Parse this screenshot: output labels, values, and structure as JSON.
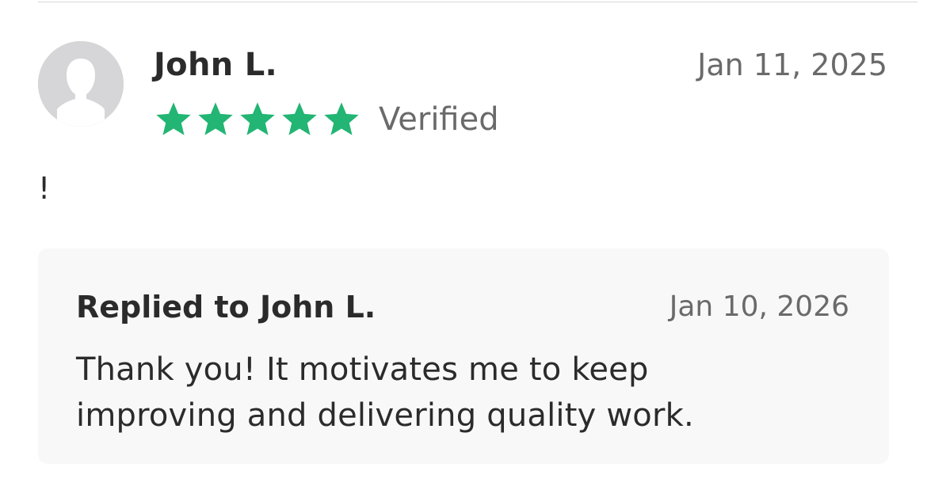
{
  "review": {
    "reviewer_name": "John L.",
    "date": "Jan 11, 2025",
    "rating": 5,
    "rating_max": 5,
    "verified_label": "Verified",
    "body": "!",
    "avatar_icon": "user-silhouette-icon",
    "star_icon": "star-icon"
  },
  "reply": {
    "title": "Replied to John L.",
    "date": "Jan 10, 2026",
    "text": "Thank you! It motivates me to keep improving and delivering quality work."
  },
  "colors": {
    "star": "#22b573",
    "avatar_bg": "#d6d6d8",
    "avatar_fg": "#ffffff",
    "muted_text": "#6a6a6a",
    "reply_bg": "#f8f8f8"
  }
}
